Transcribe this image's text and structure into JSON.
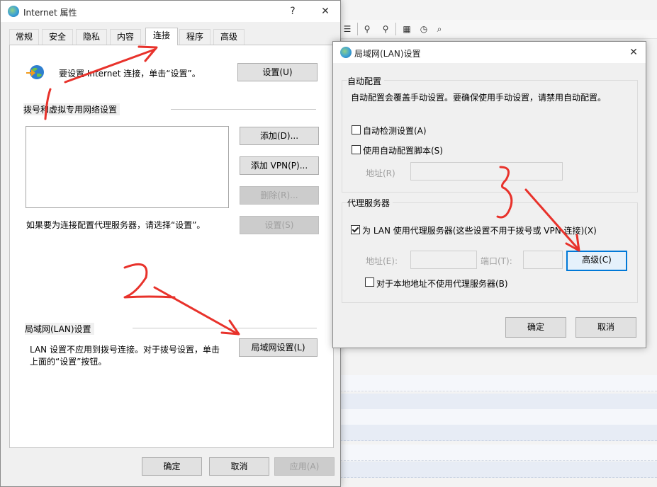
{
  "background_app": {
    "toolbar_icons": [
      "list-icon",
      "binoculars-icon",
      "binoculars-alt-icon",
      "calendar-icon",
      "clock-icon",
      "magnifier-icon"
    ]
  },
  "internet_properties": {
    "title": "Internet 属性",
    "help_glyph": "?",
    "close_glyph": "✕",
    "tabs": [
      "常规",
      "安全",
      "隐私",
      "内容",
      "连接",
      "程序",
      "高级"
    ],
    "active_tab": "连接",
    "setup_text": "要设置 Internet 连接，单击“设置”。",
    "setup_button": "设置(U)",
    "dialup_group_label": "拨号和虚拟专用网络设置",
    "add_button": "添加(D)...",
    "add_vpn_button": "添加 VPN(P)...",
    "remove_button": "删除(R)...",
    "settings_button": "设置(S)",
    "proxy_hint": "如果要为连接配置代理服务器，请选择“设置”。",
    "lan_group_label": "局域网(LAN)设置",
    "lan_text_line1": "LAN 设置不应用到拨号连接。对于拨号设置，单击",
    "lan_text_line2": "上面的“设置”按钮。",
    "lan_settings_button": "局域网设置(L)",
    "ok_button": "确定",
    "cancel_button": "取消",
    "apply_button": "应用(A)"
  },
  "lan_dialog": {
    "title": "局域网(LAN)设置",
    "close_glyph": "✕",
    "auto_group_label": "自动配置",
    "auto_desc": "自动配置会覆盖手动设置。要确保使用手动设置，请禁用自动配置。",
    "auto_detect_label": "自动检测设置(A)",
    "auto_detect_checked": false,
    "auto_script_label": "使用自动配置脚本(S)",
    "auto_script_checked": false,
    "address_label": "地址(R)",
    "address_value": "",
    "proxy_group_label": "代理服务器",
    "use_proxy_label": "为 LAN 使用代理服务器(这些设置不用于拨号或 VPN 连接)(X)",
    "use_proxy_checked": true,
    "proxy_address_label": "地址(E):",
    "proxy_address_value": "",
    "port_label": "端口(T):",
    "port_value": "",
    "advanced_button": "高级(C)",
    "bypass_local_label": "对于本地地址不使用代理服务器(B)",
    "bypass_local_checked": false,
    "ok_button": "确定",
    "cancel_button": "取消"
  },
  "annotations": {
    "color": "#e8322b",
    "step1": "1",
    "step2": "2",
    "step3": "3"
  }
}
